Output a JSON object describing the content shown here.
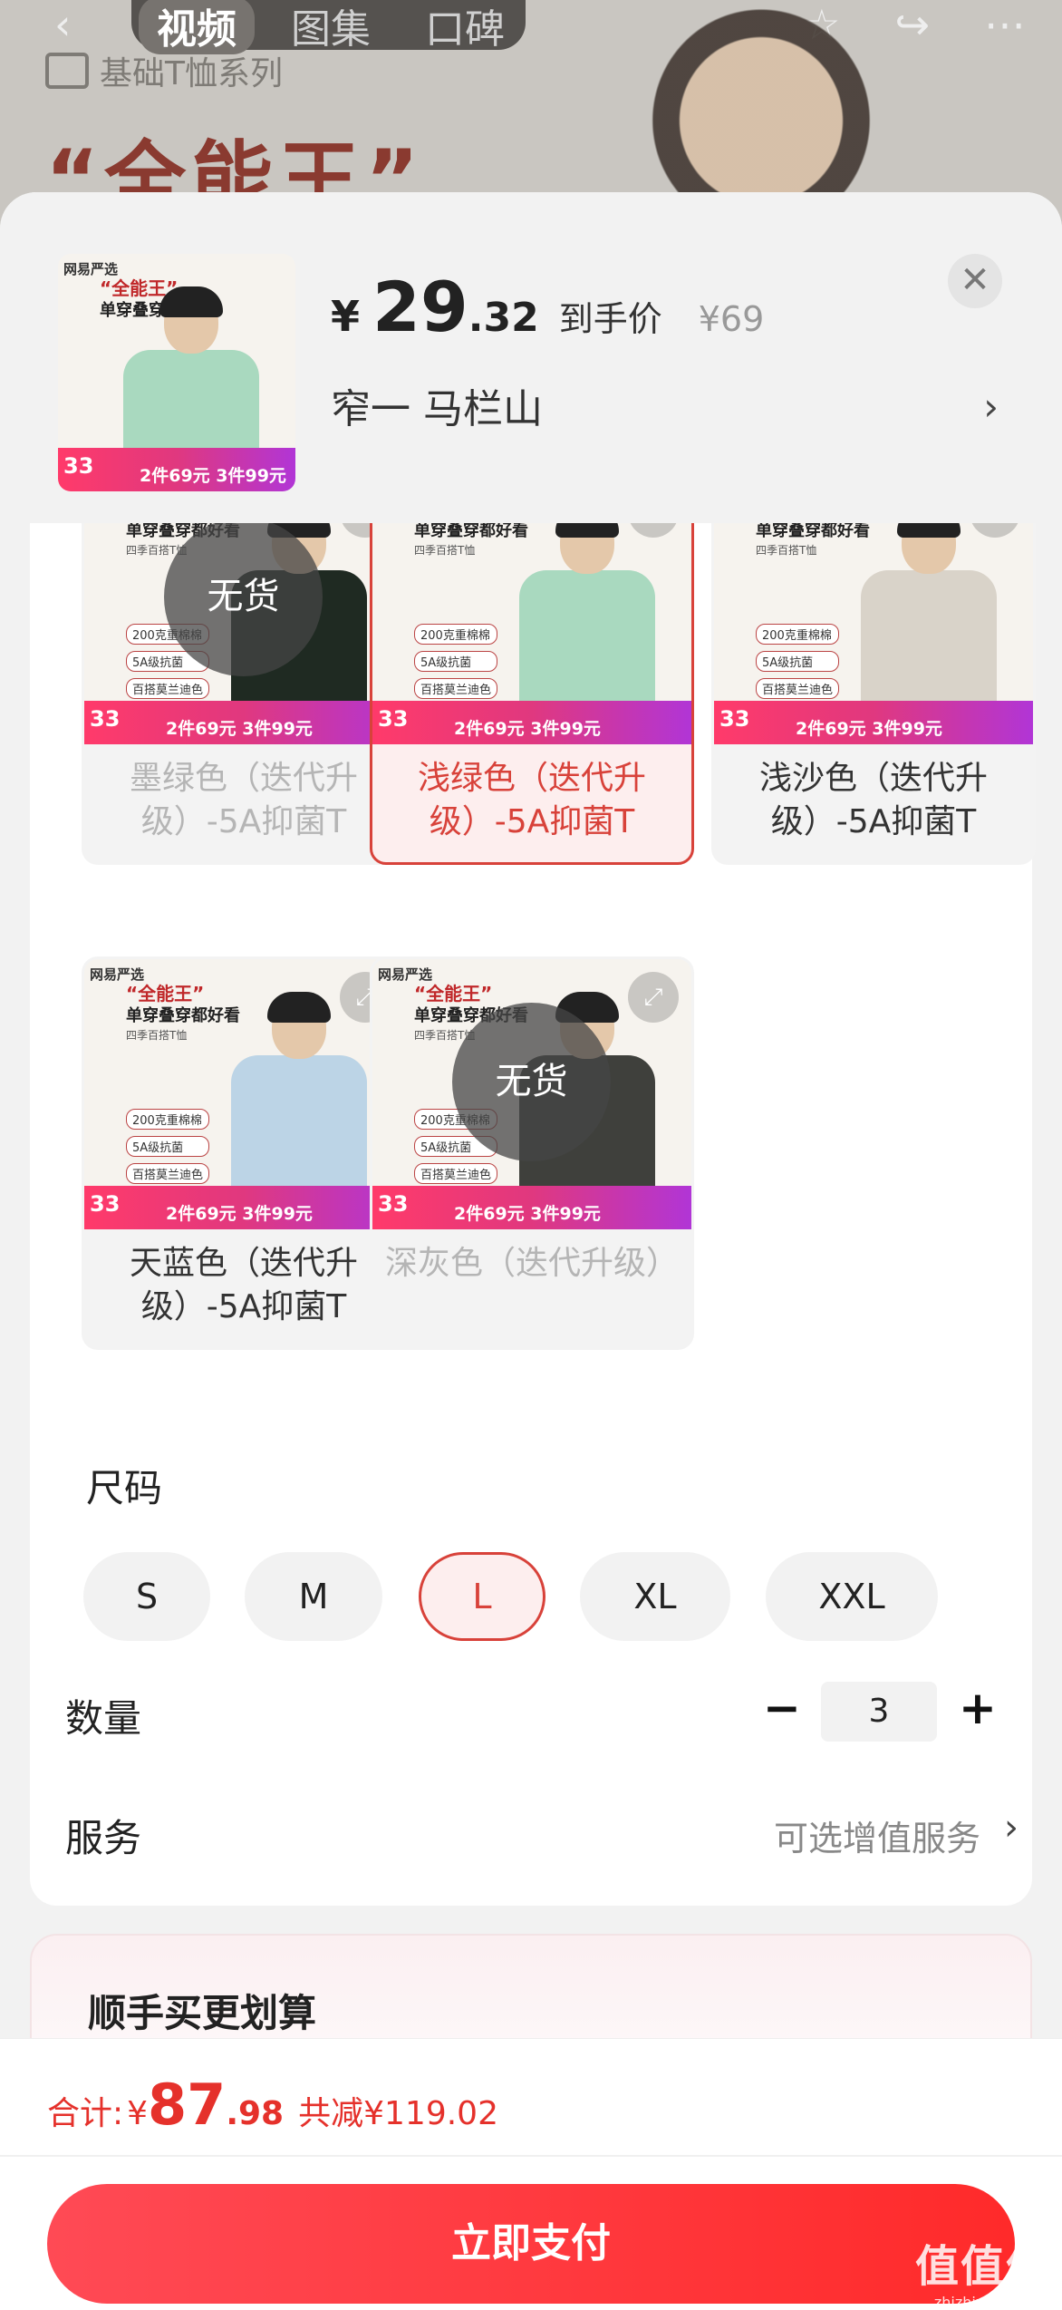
{
  "background_page": {
    "tabs": [
      "视频",
      "图集",
      "口碑"
    ],
    "active_tab": "视频",
    "series": "基础T恤系列",
    "headline": "“全能王”"
  },
  "header": {
    "currency": "¥",
    "price_int": "29",
    "price_dec": ".32",
    "price_label": "到手价",
    "original_price": "¥69",
    "selected_variant": "窄一  马栏山",
    "close_icon": "close-icon",
    "arrow_icon": "chevron-right-icon"
  },
  "product_image": {
    "brand": "网易严选",
    "series": "基础T恤系列",
    "slogan1": "“全能王”",
    "slogan2": "单穿叠穿都好看",
    "sub": "四季百搭T恤",
    "tags": [
      "200克重棉棉",
      "5A级抗菌",
      "百搭莫兰迪色"
    ],
    "promo_num": "33",
    "promo_deal": "2件69元 3件99元"
  },
  "colors": [
    {
      "label": "墨绿色（迭代升级）-5A抑菌T",
      "stock_label": "无货",
      "out_of_stock": true,
      "selected": false,
      "shirt_color": "#1f2a22"
    },
    {
      "label": "浅绿色（迭代升级）-5A抑菌T",
      "stock_label": "",
      "out_of_stock": false,
      "selected": true,
      "shirt_color": "#a9d9bf"
    },
    {
      "label": "浅沙色（迭代升级）-5A抑菌T",
      "stock_label": "",
      "out_of_stock": false,
      "selected": false,
      "shirt_color": "#d9d3c9"
    },
    {
      "label": "天蓝色（迭代升级）-5A抑菌T",
      "stock_label": "",
      "out_of_stock": false,
      "selected": false,
      "shirt_color": "#bcd4e6"
    },
    {
      "label": "深灰色（迭代升级）",
      "stock_label": "无货",
      "out_of_stock": true,
      "selected": false,
      "shirt_color": "#3f403c"
    }
  ],
  "size": {
    "title": "尺码",
    "options": [
      "S",
      "M",
      "L",
      "XL",
      "XXL"
    ],
    "selected": "L"
  },
  "quantity": {
    "title": "数量",
    "minus": "−",
    "value": "3",
    "plus": "+"
  },
  "service": {
    "title": "服务",
    "value": "可选增值服务",
    "arrow": "›"
  },
  "addon": {
    "title": "顺手买更划算"
  },
  "footer": {
    "total_label": "合计:",
    "currency": "¥",
    "total_int": "87",
    "total_dec": ".98",
    "savings": "共减¥119.02",
    "pay_button": "立即支付"
  },
  "watermark": {
    "big": "值值值",
    "small": "zhizhizhi.com"
  },
  "colors_theme": {
    "accent": "#e5312b",
    "selected_border": "#d8423a"
  }
}
